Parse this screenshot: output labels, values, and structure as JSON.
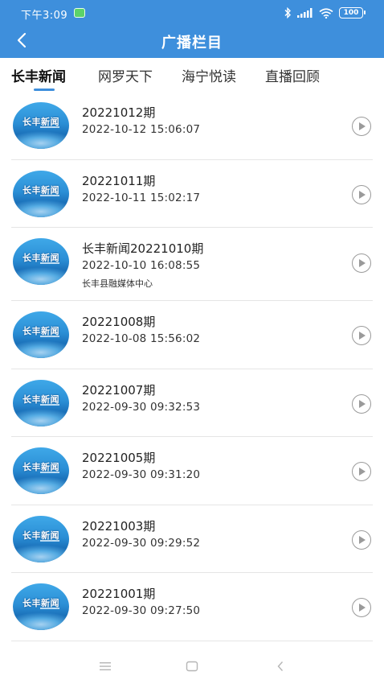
{
  "status_bar": {
    "time": "下午3:09",
    "battery": "100"
  },
  "nav": {
    "title": "广播栏目",
    "back_icon": "chevron-left-icon"
  },
  "tabs": [
    {
      "label": "长丰新闻",
      "active": true
    },
    {
      "label": "网罗天下",
      "active": false
    },
    {
      "label": "海宁悦读",
      "active": false
    },
    {
      "label": "直播回顾",
      "active": false
    }
  ],
  "thumbnail": {
    "logo_text": "长丰新闻"
  },
  "episodes": [
    {
      "title": "20221012期",
      "date": "2022-10-12 15:06:07",
      "source": ""
    },
    {
      "title": "20221011期",
      "date": "2022-10-11 15:02:17",
      "source": ""
    },
    {
      "title": "长丰新闻20221010期",
      "date": "2022-10-10 16:08:55",
      "source": "长丰县融媒体中心"
    },
    {
      "title": "20221008期",
      "date": "2022-10-08 15:56:02",
      "source": ""
    },
    {
      "title": "20221007期",
      "date": "2022-09-30 09:32:53",
      "source": ""
    },
    {
      "title": "20221005期",
      "date": "2022-09-30 09:31:20",
      "source": ""
    },
    {
      "title": "20221003期",
      "date": "2022-09-30 09:29:52",
      "source": ""
    },
    {
      "title": "20221001期",
      "date": "2022-09-30 09:27:50",
      "source": ""
    }
  ],
  "colors": {
    "header_bg": "#3e8fdc",
    "tab_indicator": "#3e8fdc",
    "play_icon": "#9a9a9a"
  }
}
